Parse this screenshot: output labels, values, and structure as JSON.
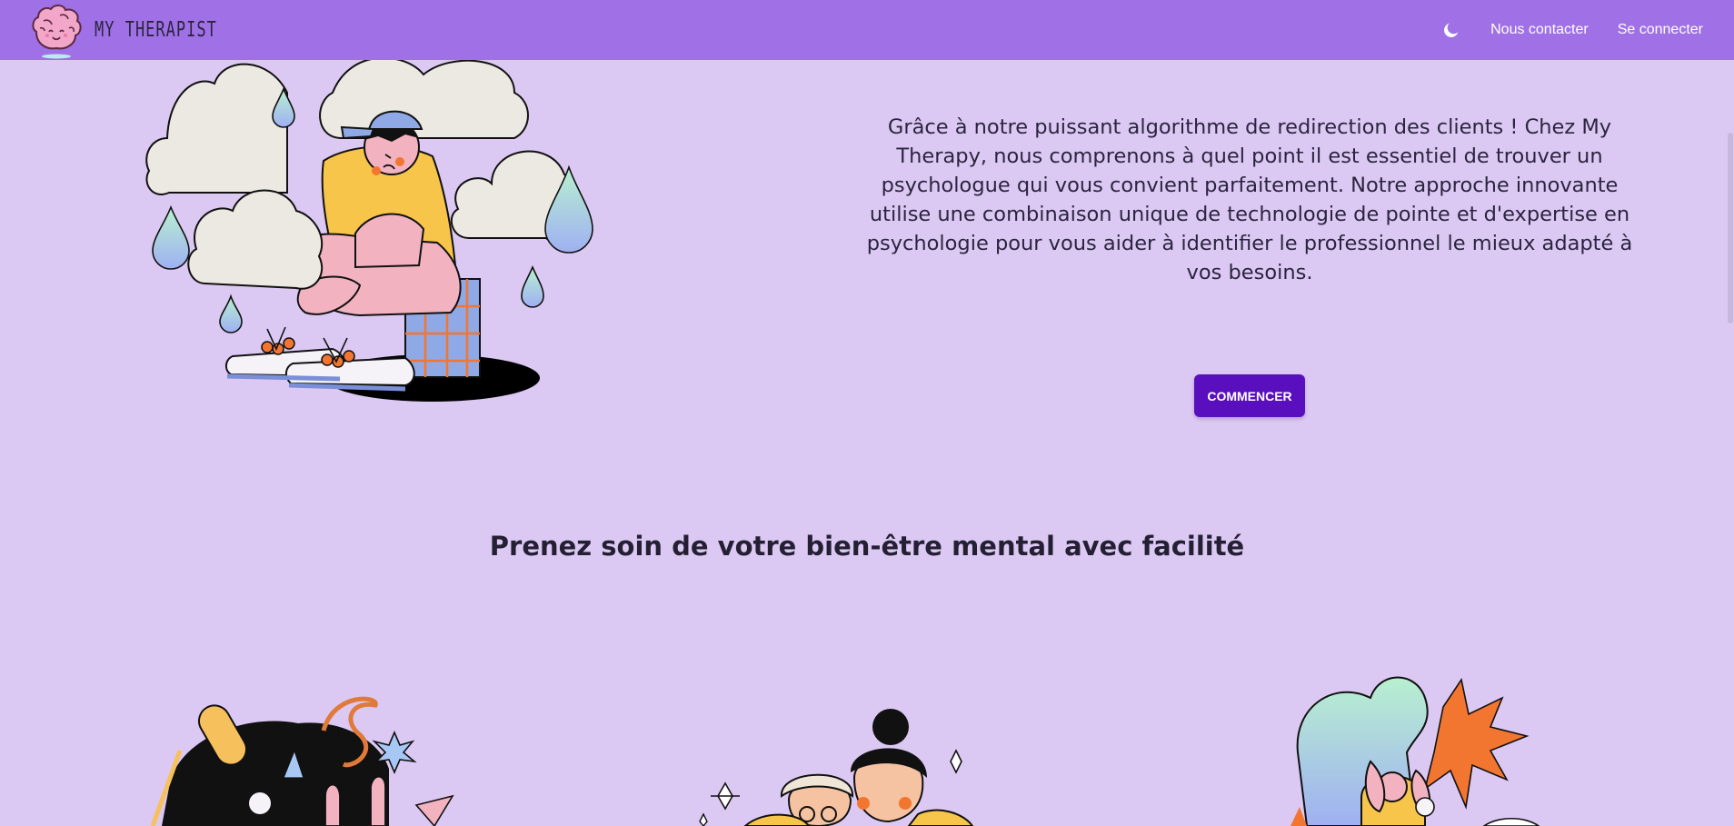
{
  "navbar": {
    "brand_name": "MY THERAPIST",
    "links": {
      "contact": "Nous contacter",
      "login": "Se connecter"
    },
    "theme_icon": "moon-icon"
  },
  "hero": {
    "paragraph": "Grâce à notre puissant algorithme de redirection des clients ! Chez My Therapy, nous comprenons à quel point il est essentiel de trouver un psychologue qui vous convient parfaitement. Notre approche innovante utilise une combinaison unique de technologie de pointe et d'expertise en psychologie pour vous aider à identifier le professionnel le mieux adapté à vos besoins.",
    "cta_label": "COMMENCER"
  },
  "features": {
    "heading": "Prenez soin de votre bien-être mental avec facilité"
  },
  "colors": {
    "navbar_bg": "#a071e6",
    "page_bg": "#dcc9f3",
    "cta_bg": "#5a0fbf"
  }
}
